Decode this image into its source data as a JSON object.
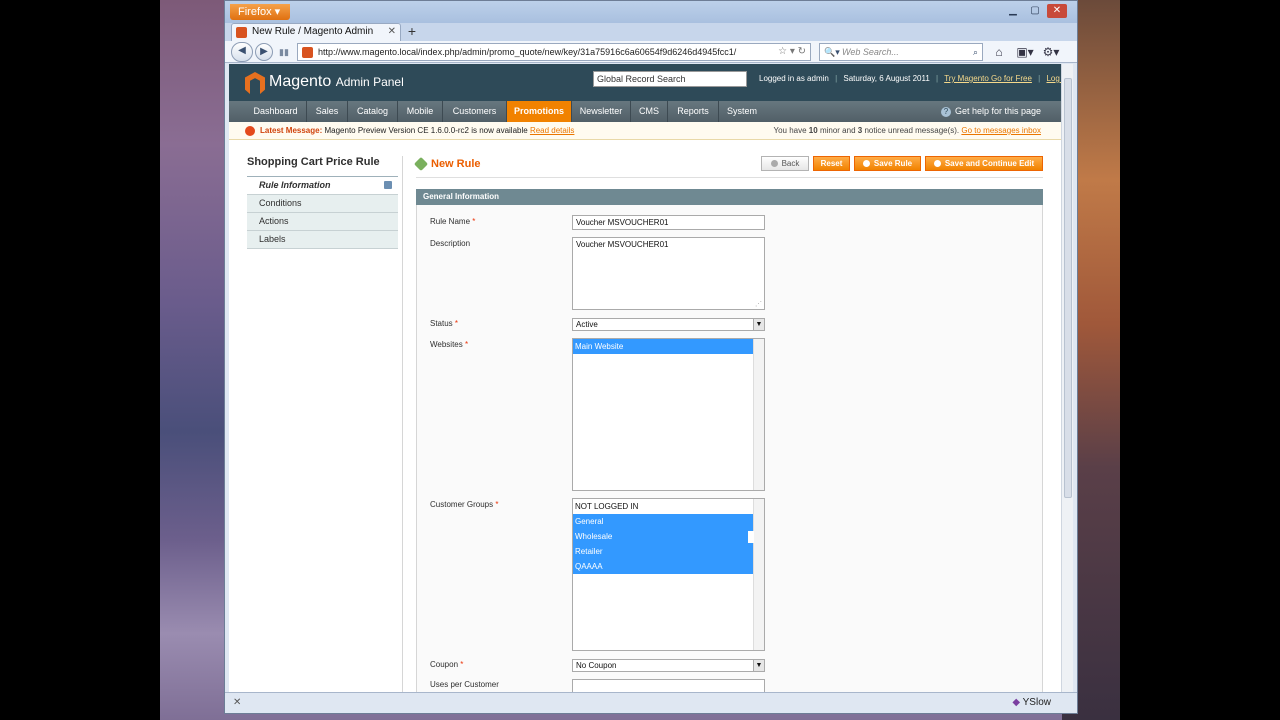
{
  "browser": {
    "app_button": "Firefox",
    "tab_title": "New Rule / Magento Admin",
    "new_tab": "+",
    "url": "http://www.magento.local/index.php/admin/promo_quote/new/key/31a75916c6a60654f9d6246d4945fcc1/",
    "search_placeholder": "Web Search...",
    "status_right": "YSlow",
    "status_left": "✕"
  },
  "header": {
    "logo_text": "Magento",
    "logo_sub": "Admin Panel",
    "global_search": "Global Record Search",
    "logged_in": "Logged in as admin",
    "date": "Saturday, 6 August 2011",
    "try_link": "Try Magento Go for Free",
    "logout": "Log Out"
  },
  "nav": {
    "items": [
      "Dashboard",
      "Sales",
      "Catalog",
      "Mobile",
      "Customers",
      "Promotions",
      "Newsletter",
      "CMS",
      "Reports",
      "System"
    ],
    "active": "Promotions",
    "help": "Get help for this page"
  },
  "message": {
    "label": "Latest Message:",
    "text": "Magento Preview Version CE 1.6.0.0-rc2 is now available",
    "link": "Read details",
    "right_pre": "You have",
    "minor_count": "10",
    "right_mid": "minor and",
    "notice_count": "3",
    "right_post": "notice unread message(s).",
    "inbox_link": "Go to messages inbox"
  },
  "sidebar": {
    "title": "Shopping Cart Price Rule",
    "tabs": [
      "Rule Information",
      "Conditions",
      "Actions",
      "Labels"
    ]
  },
  "page": {
    "title": "New Rule",
    "buttons": {
      "back": "Back",
      "reset": "Reset",
      "save": "Save Rule",
      "save_continue": "Save and Continue Edit"
    }
  },
  "form": {
    "section_title": "General Information",
    "rule_name_label": "Rule Name",
    "rule_name_value": "Voucher MSVOUCHER01",
    "description_label": "Description",
    "description_value": "Voucher MSVOUCHER01",
    "status_label": "Status",
    "status_value": "Active",
    "websites_label": "Websites",
    "websites_options": [
      "Main Website"
    ],
    "customer_groups_label": "Customer Groups",
    "customer_groups_options": [
      "NOT LOGGED IN",
      "General",
      "Wholesale",
      "Retailer",
      "QAAAA"
    ],
    "customer_groups_selected": [
      "General",
      "Wholesale",
      "Retailer",
      "QAAAA"
    ],
    "coupon_label": "Coupon",
    "coupon_value": "No Coupon",
    "uses_per_customer_label": "Uses per Customer",
    "required_mark": "*"
  },
  "colors": {
    "accent_orange": "#f18200",
    "header_bg": "#2e4a58",
    "selection_blue": "#3399ff"
  }
}
